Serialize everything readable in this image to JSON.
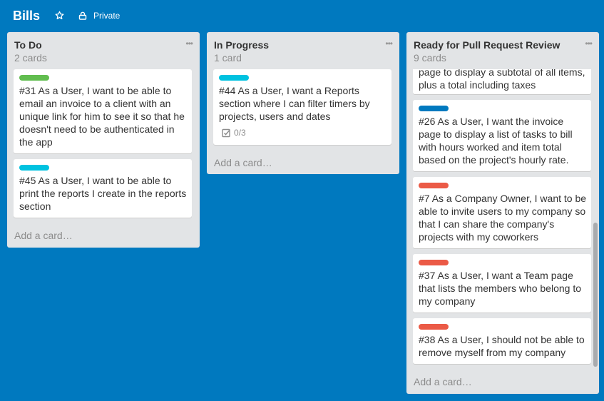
{
  "board": {
    "title": "Bills",
    "visibility": "Private",
    "background_color": "#0079bf"
  },
  "lists": [
    {
      "title": "To Do",
      "count": "2 cards",
      "add_card": "Add a card…",
      "cards": [
        {
          "label_color": "#61bd4f",
          "text": "#31 As a User, I want to be able to email an invoice to a client with an unique link for him to see it so that he doesn't need to be authenticated in the app"
        },
        {
          "label_color": "#00c2e0",
          "text": "#45 As a User, I want to be able to print the reports I create in the reports section"
        }
      ]
    },
    {
      "title": "In Progress",
      "count": "1 card",
      "add_card": "Add a card…",
      "cards": [
        {
          "label_color": "#00c2e0",
          "text": "#44 As a User, I want a Reports section where I can filter timers by projects, users and dates",
          "checklist": "0/3"
        }
      ]
    },
    {
      "title": "Ready for Pull Request Review",
      "count": "9 cards",
      "add_card": "Add a card…",
      "cards": [
        {
          "text": "page to display a subtotal of all items, plus a total including taxes"
        },
        {
          "label_color": "#0079bf",
          "text": "#26 As a User, I want the invoice page to display a list of tasks to bill with hours worked and item total based on the project's hourly rate."
        },
        {
          "label_color": "#eb5a46",
          "text": "#7 As a Company Owner, I want to be able to invite users to my company so that I can share the company's projects with my coworkers"
        },
        {
          "label_color": "#eb5a46",
          "text": "#37 As a User, I want a Team page that lists the members who belong to my company"
        },
        {
          "label_color": "#eb5a46",
          "text": "#38 As a User, I should not be able to remove myself from my company"
        }
      ]
    }
  ],
  "icons": {
    "star": "star-icon",
    "lock": "lock-icon",
    "menu": "ellipsis-icon",
    "checklist": "checkbox-icon"
  }
}
